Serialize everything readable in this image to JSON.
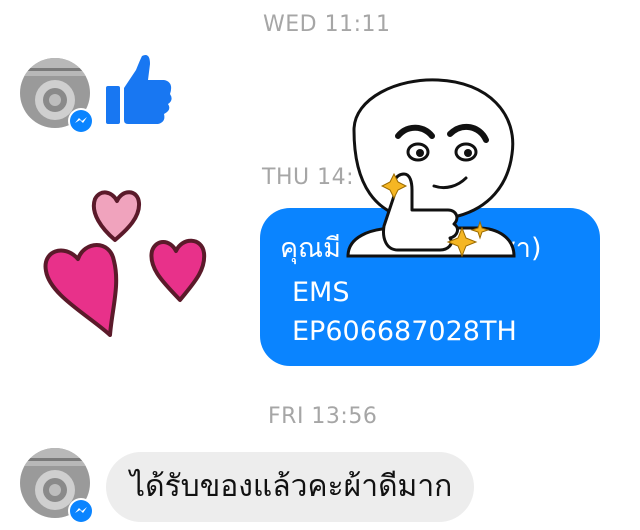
{
  "conversation": {
    "timestamps": {
      "wed": "WED 11:11",
      "thu": "THU 14:",
      "fri": "FRI 13:56"
    },
    "messages": {
      "sent_text": {
        "line1": "คุณมี",
        "line1_tail": "ว์ใบชา)",
        "line2": "EMS",
        "line3": "EP606687028TH"
      },
      "received_text": "ได้รับของแล้วคะผ้าดีมาก"
    },
    "icons": {
      "like": "thumbs-up-icon",
      "badge": "messenger-icon",
      "hearts": "hearts-sticker",
      "sticker": "thumbs-up-character-sticker"
    },
    "colors": {
      "accent": "#0a84ff",
      "like": "#1877f2",
      "heart_pink": "#e8318a",
      "heart_light": "#f0a3bd",
      "timestamp": "#a6a6a6",
      "received_bubble": "#ededed"
    }
  }
}
